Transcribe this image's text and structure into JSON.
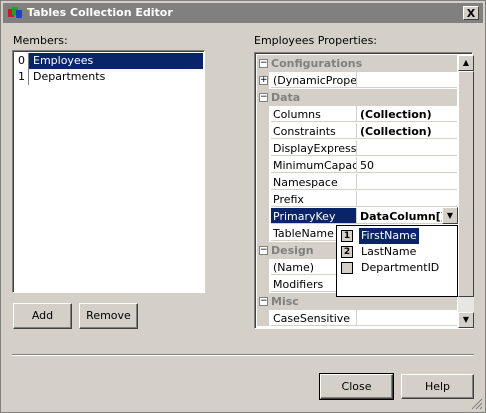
{
  "window": {
    "title": "Tables Collection Editor",
    "close_glyph": "X"
  },
  "members": {
    "label": "Members:",
    "items": [
      {
        "index": "0",
        "name": "Employees",
        "selected": true
      },
      {
        "index": "1",
        "name": "Departments",
        "selected": false
      }
    ]
  },
  "buttons": {
    "add": "Add",
    "remove": "Remove",
    "close": "Close",
    "help": "Help"
  },
  "properties": {
    "label": "Employees Properties:",
    "rows": [
      {
        "kind": "cat",
        "expand": "−",
        "text": "Configurations"
      },
      {
        "kind": "prop",
        "expand": "+",
        "name": "(DynamicPropertie",
        "value": ""
      },
      {
        "kind": "cat",
        "expand": "−",
        "text": "Data"
      },
      {
        "kind": "prop",
        "name": "Columns",
        "value": "(Collection)",
        "bold": true
      },
      {
        "kind": "prop",
        "name": "Constraints",
        "value": "(Collection)",
        "bold": true
      },
      {
        "kind": "prop",
        "name": "DisplayExpression",
        "value": ""
      },
      {
        "kind": "prop",
        "name": "MinimumCapacity",
        "value": "50"
      },
      {
        "kind": "prop",
        "name": "Namespace",
        "value": ""
      },
      {
        "kind": "prop",
        "name": "Prefix",
        "value": ""
      },
      {
        "kind": "prop",
        "name": "PrimaryKey",
        "value": "DataColumn[]",
        "bold": true,
        "selected": true
      },
      {
        "kind": "prop",
        "name": "TableName",
        "value": ""
      },
      {
        "kind": "cat",
        "expand": "−",
        "text": "Design"
      },
      {
        "kind": "prop",
        "name": "(Name)",
        "value": ""
      },
      {
        "kind": "prop",
        "name": "Modifiers",
        "value": ""
      },
      {
        "kind": "cat",
        "expand": "−",
        "text": "Misc"
      },
      {
        "kind": "prop",
        "name": "CaseSensitive",
        "value": ""
      }
    ]
  },
  "primary_key_dropdown": {
    "items": [
      {
        "order": "1",
        "name": "FirstName",
        "selected": true
      },
      {
        "order": "2",
        "name": "LastName",
        "selected": false
      },
      {
        "order": "",
        "name": "DepartmentID",
        "selected": false
      }
    ]
  },
  "icons": {
    "scroll_up": "up-arrow-icon",
    "scroll_down": "down-arrow-icon",
    "dropdown": "down-arrow-icon"
  },
  "colors": {
    "selection": "#0a246a",
    "face": "#d4d0c8",
    "titlebar_inactive": "#808080"
  }
}
